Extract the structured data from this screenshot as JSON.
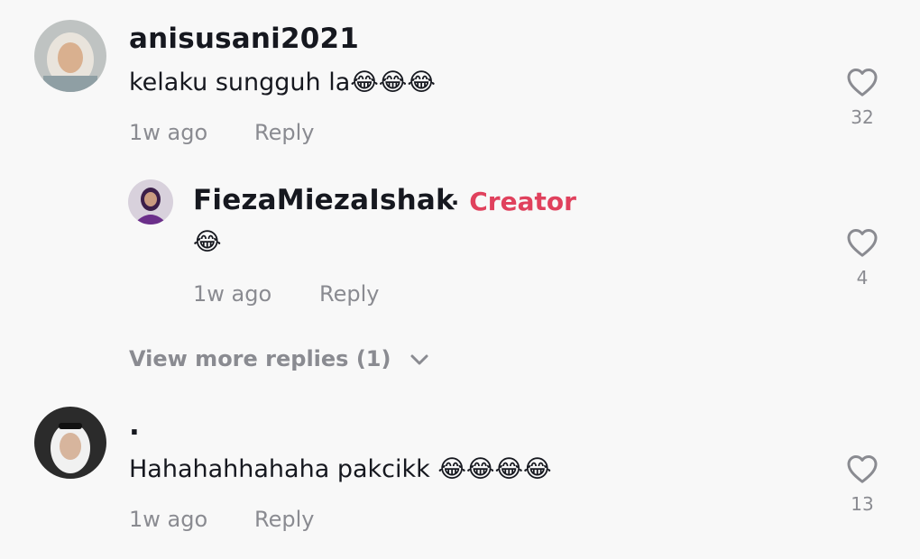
{
  "comments": [
    {
      "username": "anisusani2021",
      "text": "kelaku sungguh la😂😂😂",
      "time": "1w ago",
      "reply_label": "Reply",
      "likes": "32"
    },
    {
      "username": "FiezaMiezaIshak",
      "separator": "·",
      "badge": "Creator",
      "text": "😂",
      "time": "1w ago",
      "reply_label": "Reply",
      "likes": "4"
    },
    {
      "username": "·",
      "text": "Hahahahhahaha pakcikk 😂😂😂😂",
      "time": "1w ago",
      "reply_label": "Reply",
      "likes": "13"
    }
  ],
  "view_more": "View more replies (1)",
  "colors": {
    "background": "#f8f8f8",
    "creator_badge": "#e0415d",
    "muted": "#8a8b91",
    "text": "#16181f"
  },
  "icons": {
    "like": "heart-outline-icon",
    "expand": "chevron-down-icon"
  }
}
